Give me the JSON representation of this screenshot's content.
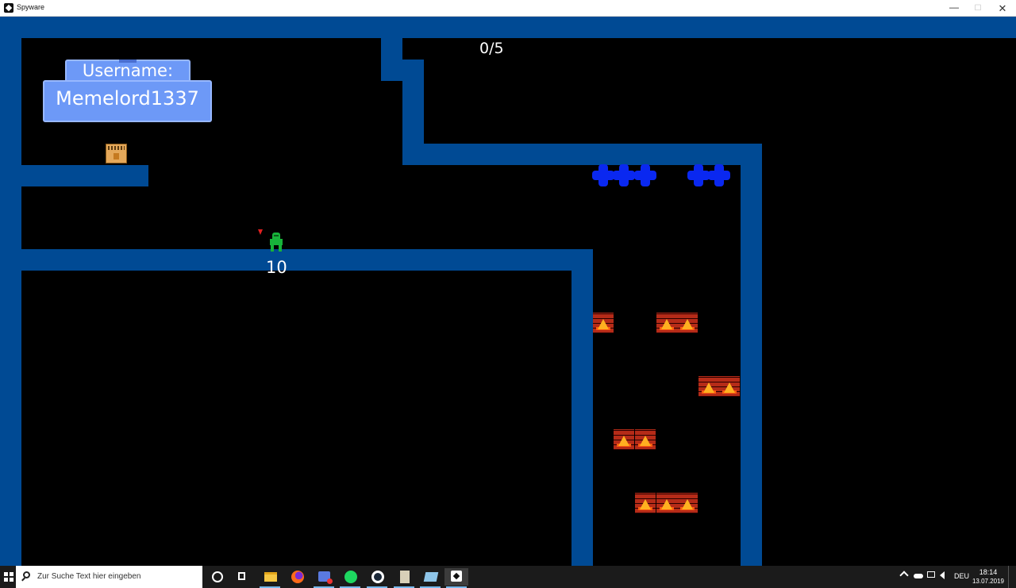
{
  "window": {
    "title": "Spyware",
    "minimize": "—",
    "maximize": "☐",
    "close": "✕"
  },
  "game": {
    "collected_counter": "0/5",
    "player_value": "10",
    "username_label": "Username:",
    "username": "Memelord1337",
    "colors": {
      "wall": "#004a94",
      "background": "#000000",
      "username_box": "#6d99f7",
      "player": "#17b33a",
      "cross": "#0a28f0",
      "fire": "#b52b18"
    },
    "sprites": [
      "chest-icon",
      "player-icon",
      "health-cross-icon",
      "fire-trap-icon"
    ]
  },
  "taskbar": {
    "search_placeholder": "Zur Suche Text hier eingeben",
    "language": "DEU",
    "time": "18:14",
    "date": "13.07.2019",
    "pinned_apps": [
      "cortana",
      "task-view",
      "file-explorer",
      "firefox",
      "snipping-tool",
      "spotify",
      "steam",
      "notepad",
      "photos",
      "spyware"
    ]
  }
}
